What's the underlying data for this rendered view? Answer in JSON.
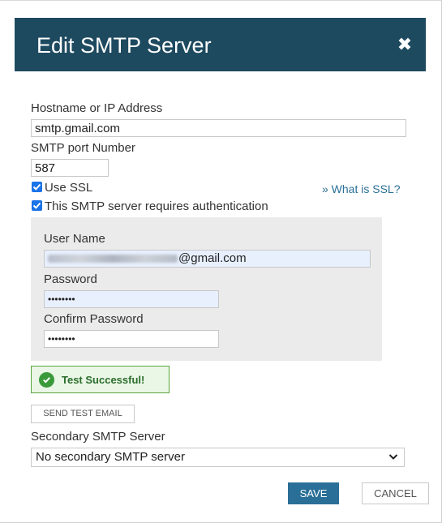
{
  "dialog": {
    "title": "Edit SMTP Server",
    "close_icon": "close-icon",
    "header_color": "#1e4a60"
  },
  "fields": {
    "hostname_label": "Hostname or IP Address",
    "hostname_value": "smtp.gmail.com",
    "port_label": "SMTP port Number",
    "port_value": "587",
    "use_ssl_label": "Use SSL",
    "use_ssl_checked": true,
    "ssl_link": "» What is SSL?",
    "auth_label": "This SMTP server requires authentication",
    "auth_checked": true
  },
  "auth": {
    "username_label": "User Name",
    "username_value_suffix": "@gmail.com",
    "password_label": "Password",
    "password_value": "••••••••",
    "confirm_label": "Confirm Password",
    "confirm_value": "••••••••"
  },
  "test": {
    "status_text": "Test Successful!",
    "status_icon": "check-circle-icon",
    "status_color": "#3a9a3a",
    "send_button": "SEND TEST EMAIL"
  },
  "secondary": {
    "label": "Secondary SMTP Server",
    "selected": "No secondary SMTP server"
  },
  "actions": {
    "save": "SAVE",
    "cancel": "CANCEL",
    "accent": "#2a6f97"
  }
}
